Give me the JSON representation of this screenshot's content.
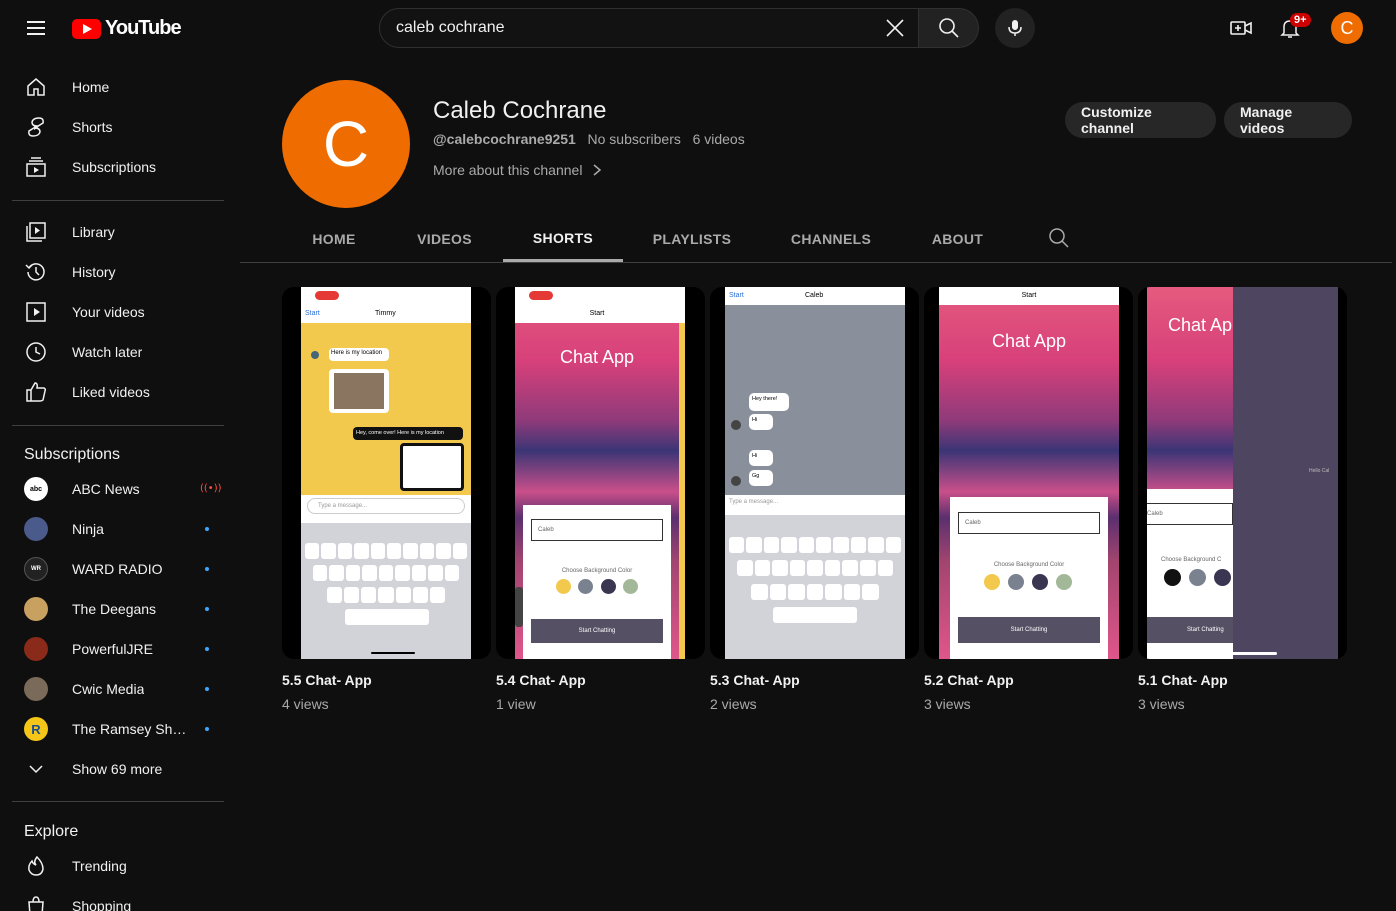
{
  "topbar": {
    "logo_text": "YouTube",
    "search_value": "caleb cochrane",
    "notifications_badge": "9+",
    "avatar_letter": "C"
  },
  "sidebar": {
    "main": [
      {
        "label": "Home",
        "icon": "home-icon"
      },
      {
        "label": "Shorts",
        "icon": "shorts-icon"
      },
      {
        "label": "Subscriptions",
        "icon": "subscriptions-icon"
      }
    ],
    "you": [
      {
        "label": "Library",
        "icon": "library-icon"
      },
      {
        "label": "History",
        "icon": "history-icon"
      },
      {
        "label": "Your videos",
        "icon": "your-videos-icon"
      },
      {
        "label": "Watch later",
        "icon": "watch-later-icon"
      },
      {
        "label": "Liked videos",
        "icon": "liked-videos-icon"
      }
    ],
    "subscriptions_heading": "Subscriptions",
    "subscriptions": [
      {
        "label": "ABC News",
        "status": "live"
      },
      {
        "label": "Ninja",
        "status": "new"
      },
      {
        "label": "WARD RADIO",
        "status": "new"
      },
      {
        "label": "The Deegans",
        "status": "new"
      },
      {
        "label": "PowerfulJRE",
        "status": "new"
      },
      {
        "label": "Cwic Media",
        "status": "new"
      },
      {
        "label": "The Ramsey Sho...",
        "status": "new"
      }
    ],
    "show_more": "Show 69 more",
    "explore_heading": "Explore",
    "explore": [
      {
        "label": "Trending",
        "icon": "trending-icon"
      },
      {
        "label": "Shopping",
        "icon": "shopping-icon"
      }
    ]
  },
  "channel": {
    "avatar_letter": "C",
    "name": "Caleb Cochrane",
    "handle": "@calebcochrane9251",
    "subscribers": "No subscribers",
    "videos_count": "6 videos",
    "about_link": "More about this channel",
    "customize_label": "Customize channel",
    "manage_label": "Manage videos"
  },
  "tabs": [
    {
      "label": "HOME",
      "active": false
    },
    {
      "label": "VIDEOS",
      "active": false
    },
    {
      "label": "SHORTS",
      "active": true
    },
    {
      "label": "PLAYLISTS",
      "active": false
    },
    {
      "label": "CHANNELS",
      "active": false
    },
    {
      "label": "ABOUT",
      "active": false
    }
  ],
  "shorts": [
    {
      "title": "5.5 Chat- App",
      "views": "4 views"
    },
    {
      "title": "5.4 Chat- App",
      "views": "1 view"
    },
    {
      "title": "5.3 Chat- App",
      "views": "2 views"
    },
    {
      "title": "5.2 Chat- App",
      "views": "3 views"
    },
    {
      "title": "5.1 Chat- App",
      "views": "3 views"
    }
  ],
  "thumb_text": {
    "t1_contact": "Timmy",
    "t1_back": "Start",
    "t1_msg1": "Here is my location",
    "t1_msg2": "Hey, come over! Here is my location",
    "t1_input": "Type a message...",
    "t2_title": "Chat App",
    "t2_start": "Start",
    "t2_name": "Caleb",
    "t2_choose": "Choose Background Color",
    "t2_button": "Start Chatting",
    "t3_contact": "Caleb",
    "t3_back": "Start",
    "t3_msg1": "Hey there!",
    "t3_msg2": "Hi",
    "t3_msg3": "Hi",
    "t3_msg4": "Gg",
    "t3_input": "Type a message...",
    "t4_start": "Start",
    "t4_title": "Chat App",
    "t4_name": "Caleb",
    "t4_choose": "Choose Background Color",
    "t4_button": "Start Chatting",
    "t5_title": "Chat Ap",
    "t5_name": "Caleb",
    "t5_choose": "Choose Background C",
    "t5_button": "Start Chatting",
    "t5_side": "Hello Cal"
  },
  "colors": {
    "accent_orange": "#ef6c00",
    "brand_red": "#ff0000",
    "chat_yellow": "#f2c94c",
    "swatch_gray": "#7a8290",
    "swatch_dark": "#3a3550",
    "swatch_green": "#a3b899"
  }
}
